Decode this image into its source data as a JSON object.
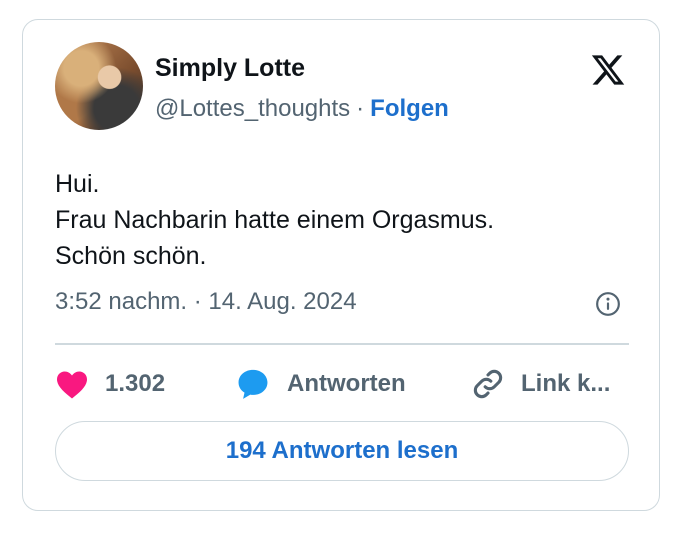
{
  "author": {
    "name": "Simply Lotte",
    "handle": "@Lottes_thoughts",
    "separator": "·",
    "follow_label": "Folgen"
  },
  "tweet": {
    "lines": [
      "Hui.",
      "Frau Nachbarin hatte einem Orgasmus.",
      "Schön schön."
    ],
    "timestamp": "3:52 nachm. · 14. Aug. 2024"
  },
  "actions": {
    "like_count": "1.302",
    "reply_label": "Antworten",
    "link_label": "Link k..."
  },
  "read_replies_label": "194 Antworten lesen",
  "icons": {
    "logo": "x-logo-icon",
    "info": "info-icon",
    "like": "heart-icon",
    "reply": "speech-bubble-icon",
    "link": "link-icon"
  },
  "colors": {
    "accent": "#1d6fcc",
    "heart": "#f91880",
    "reply_bubble": "#1d9bf0",
    "muted_text": "#536471",
    "border": "#cfd9de"
  }
}
